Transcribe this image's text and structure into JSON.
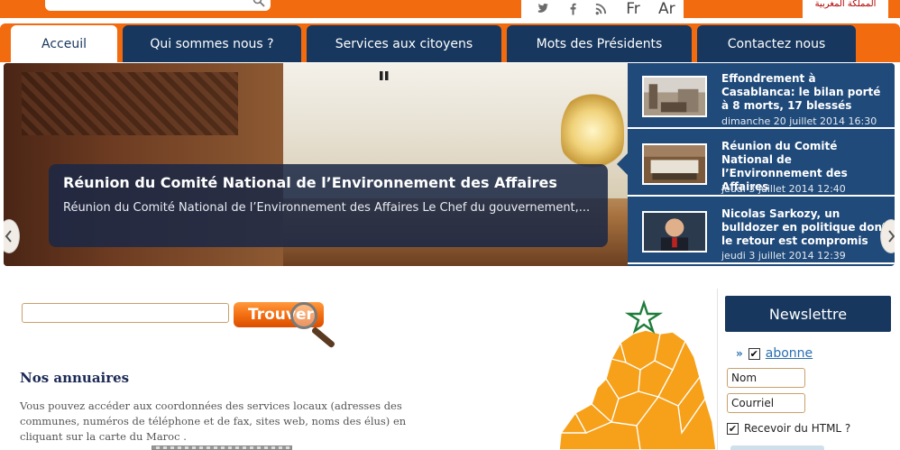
{
  "header": {
    "search_placeholder": "",
    "social": {
      "twitter": "twitter-icon",
      "facebook": "facebook-icon",
      "rss": "rss-icon"
    },
    "languages": [
      "Fr",
      "Ar"
    ],
    "logo_text": "المملكة المغربية"
  },
  "nav": {
    "items": [
      "Acceuil",
      "Qui sommes nous ?",
      "Services aux citoyens",
      "Mots des Présidents",
      "Contactez nous"
    ]
  },
  "slider": {
    "caption_title": "Réunion du Comité National de l’Environnement des Affaires",
    "caption_text": "Réunion du Comité National de l’Environnement des Affaires      Le Chef du gouvernement,...",
    "news": [
      {
        "title": "Effondrement à Casablanca: le bilan porté à 8 morts, 17 blessés",
        "date": "dimanche 20 juillet 2014 16:30"
      },
      {
        "title": "Réunion du Comité National de l’Environnement des Affaires",
        "date": "jeudi 3 juillet 2014 12:40"
      },
      {
        "title": "Nicolas Sarkozy, un bulldozer en politique dont le retour est compromis",
        "date": "jeudi 3 juillet 2014 12:39"
      }
    ]
  },
  "finder": {
    "button_label": "Trouver",
    "input_value": ""
  },
  "annuaires": {
    "title": "Nos annuaires",
    "text": "Vous pouvez accéder aux coordonnées des services locaux (adresses des communes, numéros de téléphone et de fax, sites web, noms des élus) en cliquant sur la carte du Maroc ."
  },
  "newsletter": {
    "title": "Newslettre",
    "abonne_label": "abonne",
    "name_value": "Nom",
    "email_value": "Courriel",
    "html_label": "Recevoir du HTML ?"
  },
  "colors": {
    "orange": "#f26b0f",
    "navy": "#17375e",
    "news_bg": "#1f4a7a",
    "map_orange": "#f7a11a",
    "star_green": "#1e7d3a"
  }
}
